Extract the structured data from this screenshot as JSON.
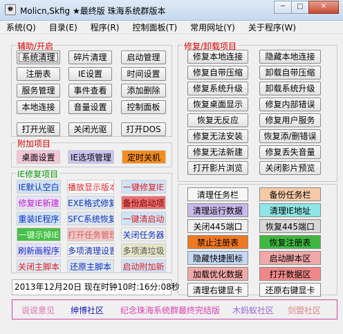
{
  "window": {
    "title": "Molicn,Skfig ★最终版 珠海系统群版本",
    "minimize_glyph": "─",
    "maximize_glyph": "□",
    "close_glyph": "✕",
    "app_icon": "♚"
  },
  "menu": [
    "系统(Q)",
    "目录(E)",
    "程序(R)",
    "控制面板(T)",
    "常用网址(Y)",
    "关于程序(W)"
  ],
  "aux": {
    "title": "辅助/开启",
    "buttons": [
      "系统清理",
      "碎片清理",
      "启动管理",
      "注册表",
      "IE设置",
      "时间设置",
      "服务管理",
      "事件查看",
      "添加删除",
      "本地连接",
      "音量设置",
      "控制面板"
    ],
    "bottom": [
      "打开光驱",
      "关闭光驱",
      "打开DOS"
    ]
  },
  "addon": {
    "title": "附加项目",
    "items": [
      "桌面设置",
      "IE选项管理",
      "定时关机"
    ]
  },
  "ie": {
    "title": "IE修复项目",
    "items": [
      "IE默认空白",
      "播放显示版本",
      "一键修复IE",
      "修复IE新建",
      "EXE格式修复",
      "备份启动项",
      "重装IE程序",
      "SFC系统恢复",
      "一键清启动",
      "一键示掉IE",
      "打开任务管理",
      "关闭任务器",
      "刷新画程序",
      "多项清理设置",
      "多项清垃圾",
      "关闭主脚本",
      "还原主脚本",
      "启动附加新"
    ]
  },
  "repair": {
    "title": "修复/卸载项目",
    "buttons": [
      "修复本地连接",
      "隐藏本地连接",
      "修复自带压缩",
      "卸载自带压缩",
      "修复系统升级",
      "卸载系统升级",
      "恢复桌面显示",
      "修复内部错误",
      "恢复无反应",
      "修复用户服务",
      "修复无法安装",
      "恢复添/删错误",
      "修复无法新建",
      "修复丢失音量",
      "打开影片浏览",
      "关闭影片预览"
    ]
  },
  "tasks": {
    "items": [
      "清理任务栏",
      "备份任务栏",
      "清理运行数据",
      "清理IE地址",
      "关闭445端口",
      "恢复445端口",
      "禁止注册表",
      "恢复注册表",
      "隐藏快捷图标",
      "启动脚本区",
      "加载优化数据",
      "打开数据区",
      "清理右键显卡",
      "还原右键显卡"
    ]
  },
  "status": "2013年12月20日  现在时钟10时:16分:08秒",
  "links": [
    "说说意见",
    "绅博社区",
    "纪念珠海系统群最终完结版",
    "木蚂蚁社区",
    "剑盟社区"
  ],
  "colors": {
    "red_label": "#d00000",
    "link_border": "#cc44aa"
  }
}
